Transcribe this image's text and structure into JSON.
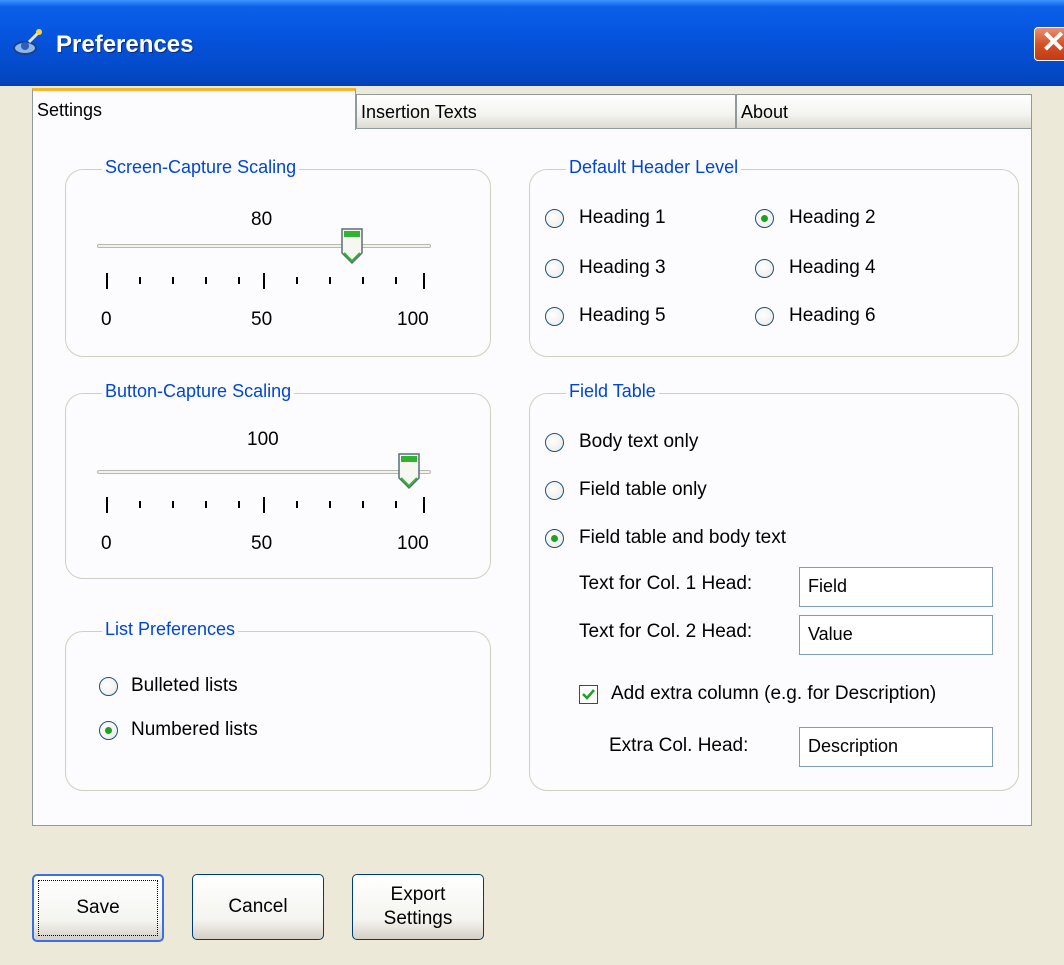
{
  "window": {
    "title": "Preferences"
  },
  "tabs": [
    {
      "label": "Settings",
      "active": true
    },
    {
      "label": "Insertion Texts",
      "active": false
    },
    {
      "label": "About",
      "active": false
    }
  ],
  "screen_capture": {
    "title": "Screen-Capture Scaling",
    "value": "80",
    "min_label": "0",
    "mid_label": "50",
    "max_label": "100",
    "level": 80
  },
  "button_capture": {
    "title": "Button-Capture Scaling",
    "value": "100",
    "min_label": "0",
    "mid_label": "50",
    "max_label": "100",
    "level": 100
  },
  "list_prefs": {
    "title": "List Preferences",
    "options": [
      {
        "label": "Bulleted lists",
        "checked": false
      },
      {
        "label": "Numbered lists",
        "checked": true
      }
    ]
  },
  "header_level": {
    "title": "Default Header Level",
    "options": [
      {
        "label": "Heading 1",
        "checked": false
      },
      {
        "label": "Heading 2",
        "checked": true
      },
      {
        "label": "Heading 3",
        "checked": false
      },
      {
        "label": "Heading 4",
        "checked": false
      },
      {
        "label": "Heading 5",
        "checked": false
      },
      {
        "label": "Heading 6",
        "checked": false
      }
    ]
  },
  "field_table": {
    "title": "Field Table",
    "options": [
      {
        "label": "Body text only",
        "checked": false
      },
      {
        "label": "Field table only",
        "checked": false
      },
      {
        "label": "Field table and body text",
        "checked": true
      }
    ],
    "col1_label": "Text for Col. 1 Head:",
    "col1_value": "Field",
    "col2_label": "Text for Col. 2 Head:",
    "col2_value": "Value",
    "extra_label": "Add extra column (e.g. for Description)",
    "extra_checked": true,
    "extra_head_label": "Extra Col. Head:",
    "extra_head_value": "Description"
  },
  "buttons": {
    "save": "Save",
    "cancel": "Cancel",
    "export_line1": "Export",
    "export_line2": "Settings"
  },
  "colors": {
    "group_title": "#0046d5",
    "titlebar": "#0553dd",
    "radio_dot": "#21a121"
  }
}
